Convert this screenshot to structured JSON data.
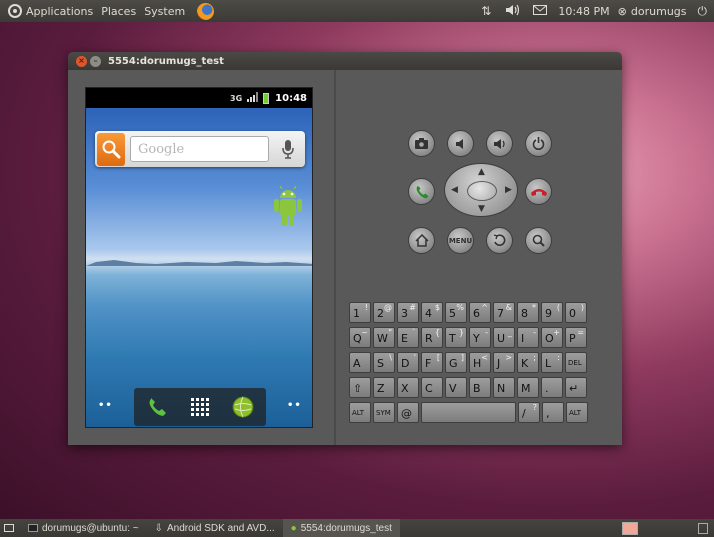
{
  "top_panel": {
    "menus": [
      "Applications",
      "Places",
      "System"
    ],
    "time": "10:48 PM",
    "user": "dorumugs"
  },
  "window": {
    "title": "5554:dorumugs_test"
  },
  "device": {
    "clock": "10:48",
    "status_3g": "3G",
    "search_placeholder": "Google",
    "dock_left_dots": "••",
    "dock_right_dots": "••"
  },
  "controls": {
    "menu_label": "MENU"
  },
  "keyboard": {
    "row1": [
      [
        "1",
        "!"
      ],
      [
        "2",
        "@"
      ],
      [
        "3",
        "#"
      ],
      [
        "4",
        "$"
      ],
      [
        "5",
        "%"
      ],
      [
        "6",
        "^"
      ],
      [
        "7",
        "&"
      ],
      [
        "8",
        "*"
      ],
      [
        "9",
        "("
      ],
      [
        "0",
        ")"
      ]
    ],
    "row2": [
      [
        "Q",
        "~"
      ],
      [
        "W",
        "\""
      ],
      [
        "E",
        "`"
      ],
      [
        "R",
        "{"
      ],
      [
        "T",
        "}"
      ],
      [
        "Y",
        "-"
      ],
      [
        "U",
        "_"
      ],
      [
        "I",
        "-"
      ],
      [
        "O",
        "+"
      ],
      [
        "P",
        "="
      ]
    ],
    "row3": [
      [
        "A",
        ""
      ],
      [
        "S",
        "\\"
      ],
      [
        "D",
        "'"
      ],
      [
        "F",
        "["
      ],
      [
        "G",
        "]"
      ],
      [
        "H",
        "<"
      ],
      [
        "J",
        ">"
      ],
      [
        "K",
        ";"
      ],
      [
        "L",
        ":"
      ],
      [
        "DEL",
        ""
      ]
    ],
    "row4": [
      [
        "⇧",
        ""
      ],
      [
        "Z",
        ""
      ],
      [
        "X",
        ""
      ],
      [
        "C",
        ""
      ],
      [
        "V",
        ""
      ],
      [
        "B",
        ""
      ],
      [
        "N",
        ""
      ],
      [
        "M",
        ""
      ],
      [
        ".",
        ""
      ],
      [
        "↵",
        ""
      ]
    ],
    "row5": [
      [
        "ALT",
        ""
      ],
      [
        "SYM",
        ""
      ],
      [
        "@",
        ""
      ],
      [
        "",
        ""
      ],
      [
        "/",
        "?"
      ],
      [
        ",",
        ""
      ],
      [
        "ALT",
        ""
      ]
    ]
  },
  "taskbar": {
    "items": [
      "dorumugs@ubuntu: ~",
      "Android SDK and AVD...",
      "5554:dorumugs_test"
    ]
  },
  "colors": {
    "panel": "#3b3a36",
    "window_body": "#595959",
    "accent_orange": "#e06a10",
    "call_green": "#2d8a2d",
    "end_red": "#c8202a"
  }
}
